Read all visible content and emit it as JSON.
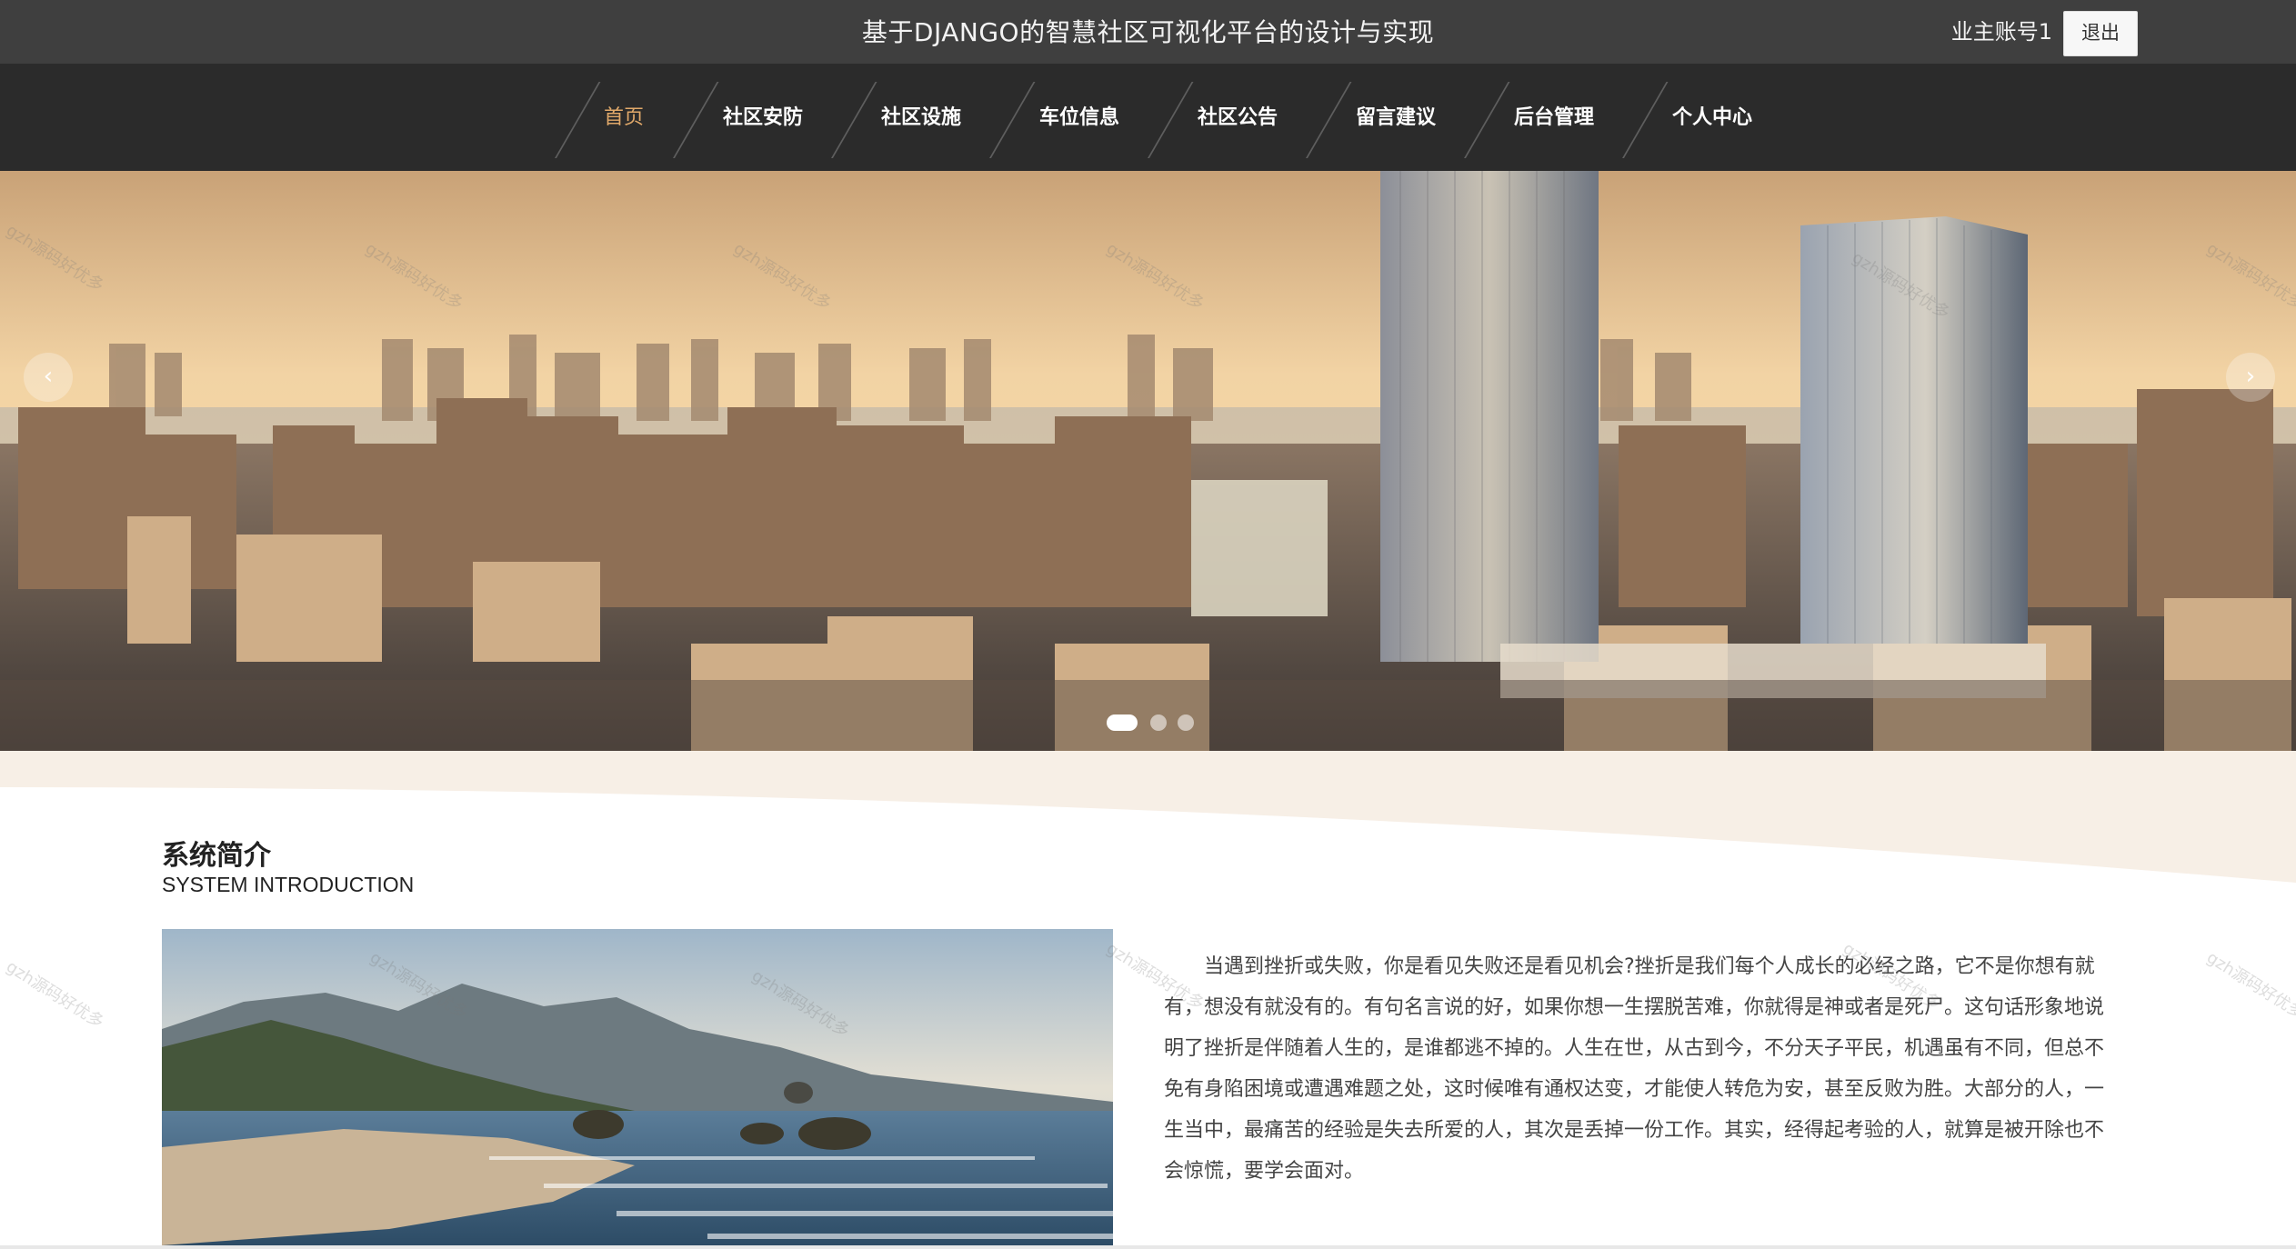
{
  "header": {
    "title": "基于DJANGO的智慧社区可视化平台的设计与实现",
    "account": "业主账号1",
    "logout_label": "退出"
  },
  "nav": {
    "items": [
      {
        "label": "首页",
        "active": true
      },
      {
        "label": "社区安防"
      },
      {
        "label": "社区设施"
      },
      {
        "label": "车位信息"
      },
      {
        "label": "社区公告"
      },
      {
        "label": "留言建议"
      },
      {
        "label": "后台管理"
      },
      {
        "label": "个人中心"
      }
    ]
  },
  "carousel": {
    "prev_icon": "chevron-left-icon",
    "next_icon": "chevron-right-icon",
    "prev_glyph": "‹",
    "next_glyph": "›",
    "active_slide": 1,
    "slide_count": 3
  },
  "intro": {
    "title": "系统简介",
    "subtitle": "SYSTEM INTRODUCTION",
    "text": "当遇到挫折或失败，你是看见失败还是看见机会?挫折是我们每个人成长的必经之路，它不是你想有就有，想没有就没有的。有句名言说的好，如果你想一生摆脱苦难，你就得是神或者是死尸。这句话形象地说明了挫折是伴随着人生的，是谁都逃不掉的。人生在世，从古到今，不分天子平民，机遇虽有不同，但总不免有身陷困境或遭遇难题之处，这时候唯有通权达变，才能使人转危为安，甚至反败为胜。大部分的人，一生当中，最痛苦的经验是失去所爱的人，其次是丢掉一份工作。其实，经得起考验的人，就算是被开除也不会惊慌，要学会面对。"
  },
  "watermark": "gzh源码好优多",
  "colors": {
    "topbar": "#3f3f3f",
    "navbar": "#2b2b2b",
    "nav_active": "#e1a96a",
    "wave": "#f7efe6"
  }
}
